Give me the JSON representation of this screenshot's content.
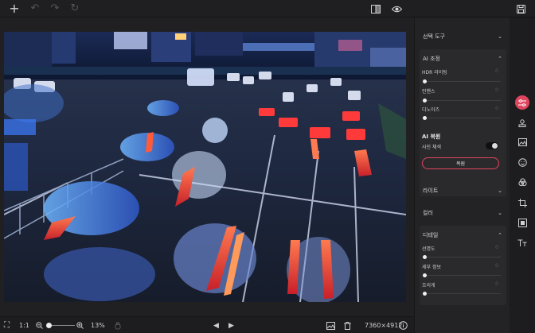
{
  "toolbar": {
    "add": "+",
    "undo": "↶",
    "redo": "↷",
    "reset": "↻",
    "compare_icon": "compare-icon",
    "preview_icon": "eye-icon",
    "save_icon": "save-icon"
  },
  "bottom": {
    "fit": "⛶",
    "ratio": "1:1",
    "zoom_out": "−",
    "zoom_in": "+",
    "zoom": "13%",
    "prev": "◀",
    "next": "▶",
    "dimensions": "7360×4912",
    "info": "i",
    "zoom_level": 0.1
  },
  "panel": {
    "select_tool": "선택 도구",
    "ai_adjust": {
      "title": "AI 조정",
      "rows": [
        {
          "label": "HDR 라이팅",
          "value": "0"
        },
        {
          "label": "인핸스",
          "value": "0"
        },
        {
          "label": "디노이즈",
          "value": "0"
        }
      ]
    },
    "ai_restore": {
      "title": "AI 복원",
      "photo_recolor": "사진 채색",
      "button": "복원"
    },
    "light": "라이트",
    "color": "컬러",
    "detail": {
      "title": "디테일",
      "rows": [
        {
          "label": "선명도",
          "value": "0"
        },
        {
          "label": "세부 정보",
          "value": "0"
        },
        {
          "label": "흐리게",
          "value": "0"
        }
      ]
    }
  },
  "rail": [
    "sliders-icon",
    "stamp-icon",
    "image-icon",
    "face-icon",
    "color-circles-icon",
    "crop-icon",
    "frame-icon",
    "text-icon"
  ],
  "colors": {
    "accent": "#e0455f",
    "panel": "#232325",
    "background": "#1b1b1d"
  }
}
